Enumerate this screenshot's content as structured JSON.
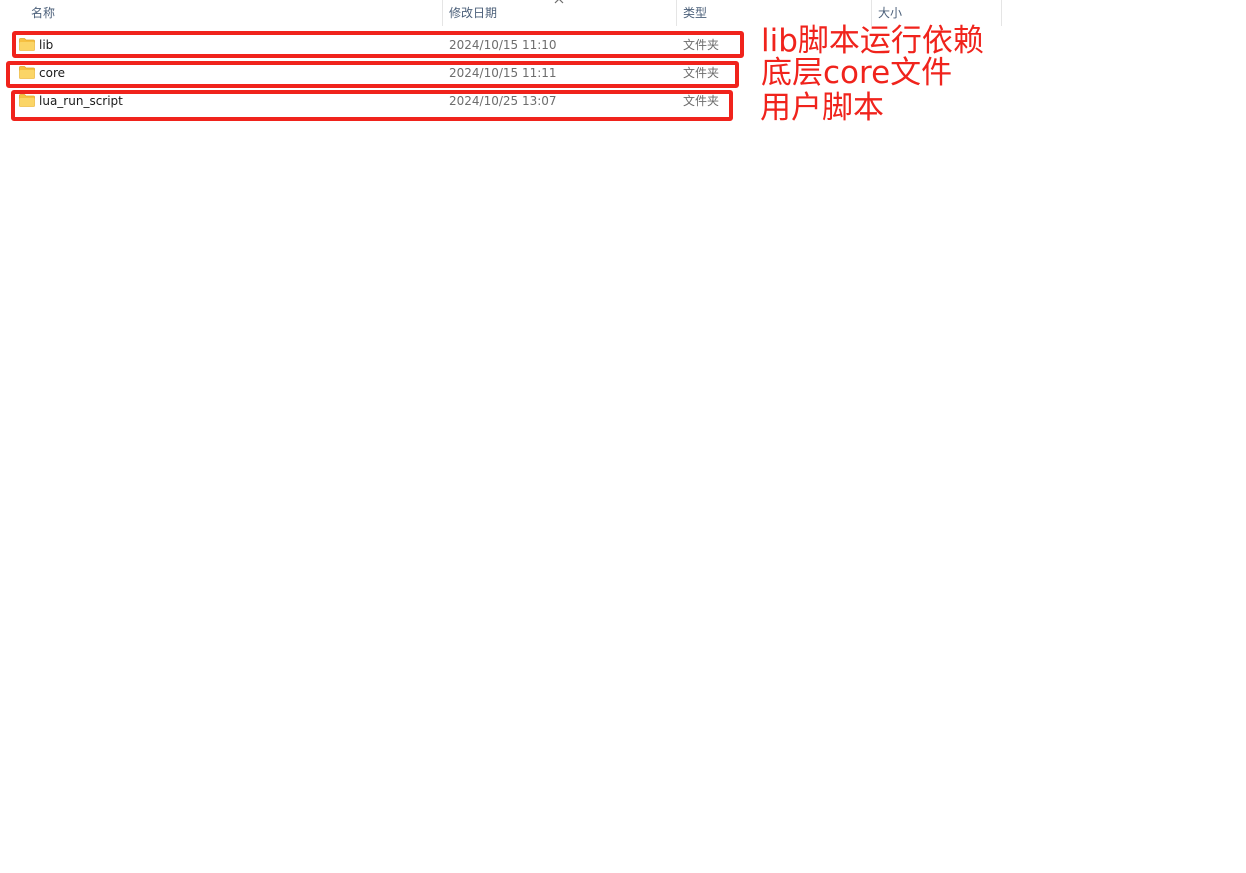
{
  "columns": {
    "name": "名称",
    "date": "修改日期",
    "type": "类型",
    "size": "大小"
  },
  "sort_indicator": "chevron-up-icon",
  "files": [
    {
      "icon": "folder-icon",
      "name": "lib",
      "date": "2024/10/15 11:10",
      "type": "文件夹",
      "size": ""
    },
    {
      "icon": "folder-icon",
      "name": "core",
      "date": "2024/10/15 11:11",
      "type": "文件夹",
      "size": ""
    },
    {
      "icon": "folder-icon",
      "name": "lua_run_script",
      "date": "2024/10/25 13:07",
      "type": "文件夹",
      "size": ""
    }
  ],
  "annotations": [
    {
      "text": "lib脚本运行依赖"
    },
    {
      "text": "底层core文件"
    },
    {
      "text": "用户脚本"
    }
  ],
  "colors": {
    "annotation": "#f0231c",
    "folder": "#f6c142",
    "header_text": "#4c607a"
  }
}
